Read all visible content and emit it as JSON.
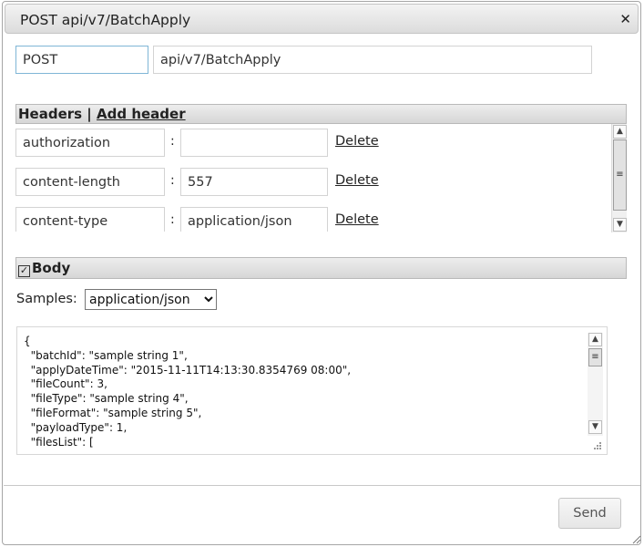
{
  "dialog": {
    "title": "POST api/v7/BatchApply",
    "close_icon": "close-icon"
  },
  "request": {
    "method": "POST",
    "url": "api/v7/BatchApply"
  },
  "headers_section": {
    "label": "Headers | ",
    "add_link": "Add header",
    "separator": ":",
    "delete_label": "Delete",
    "rows": [
      {
        "name": "authorization",
        "value": ""
      },
      {
        "name": "content-length",
        "value": "557"
      },
      {
        "name": "content-type",
        "value": "application/json"
      }
    ]
  },
  "body_section": {
    "checked": true,
    "label": "Body",
    "samples_label": "Samples:",
    "samples_selected": "application/json",
    "content": "{\n  \"batchId\": \"sample string 1\",\n  \"applyDateTime\": \"2015-11-11T14:13:30.8354769 08:00\",\n  \"fileCount\": 3,\n  \"fileType\": \"sample string 4\",\n  \"fileFormat\": \"sample string 5\",\n  \"payloadType\": 1,\n  \"filesList\": ["
  },
  "footer": {
    "send_label": "Send"
  }
}
